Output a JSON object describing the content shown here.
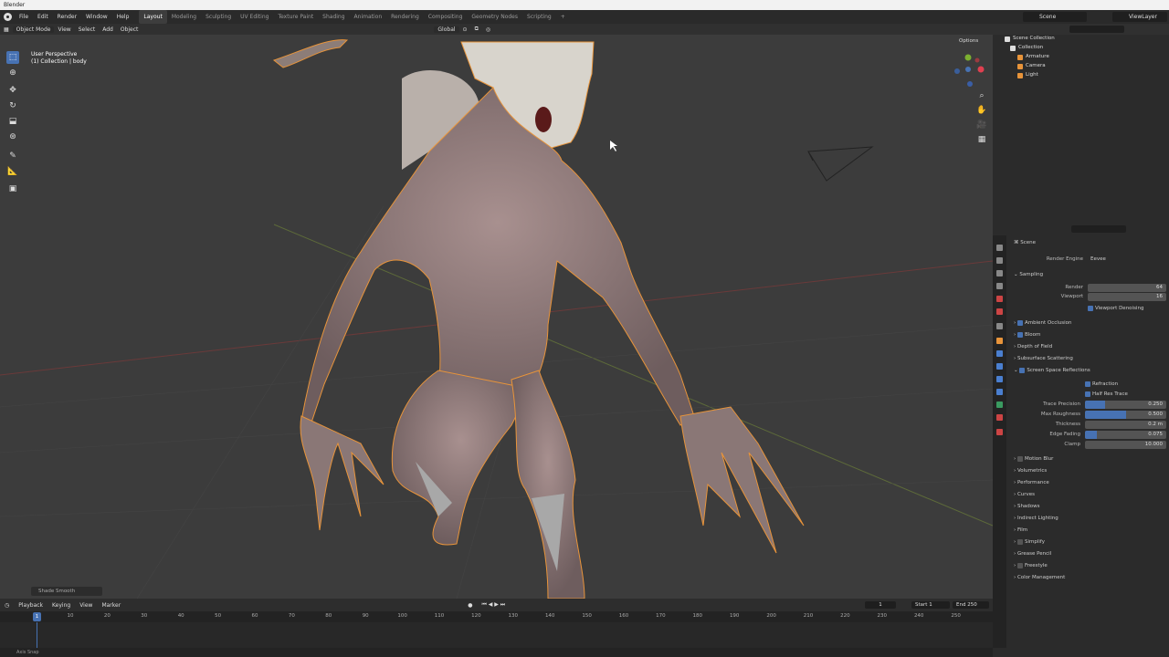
{
  "window_title": "Blender",
  "menu": [
    "File",
    "Edit",
    "Render",
    "Window",
    "Help"
  ],
  "workspaces": [
    "Layout",
    "Modeling",
    "Sculpting",
    "UV Editing",
    "Texture Paint",
    "Shading",
    "Animation",
    "Rendering",
    "Compositing",
    "Geometry Nodes",
    "Scripting",
    "+"
  ],
  "scene": "Scene",
  "view_layer": "ViewLayer",
  "viewport": {
    "mode": "Object Mode",
    "menus": [
      "View",
      "Select",
      "Add",
      "Object"
    ],
    "orientation": "Global",
    "perspective": "User Perspective",
    "collection_info": "(1) Collection | body",
    "options": "Options",
    "last_op": "Shade Smooth"
  },
  "timeline": {
    "menus": [
      "Playback",
      "Keying",
      "View",
      "Marker"
    ],
    "current_frame": "1",
    "start_label": "Start",
    "start": "1",
    "end_label": "End",
    "end": "250",
    "playhead": "1",
    "ticks": [
      "10",
      "20",
      "30",
      "40",
      "50",
      "60",
      "70",
      "80",
      "90",
      "100",
      "110",
      "120",
      "130",
      "140",
      "150",
      "160",
      "170",
      "180",
      "190",
      "200",
      "210",
      "220",
      "230",
      "240",
      "250"
    ]
  },
  "status": "Axis Snap",
  "outliner": {
    "root": "Scene Collection",
    "collection": "Collection",
    "items": [
      "Armature",
      "Camera",
      "Light"
    ]
  },
  "properties": {
    "context": "Scene",
    "render_engine_label": "Render Engine",
    "render_engine": "Eevee",
    "sampling": "Sampling",
    "render_label": "Render",
    "render_samples": "64",
    "viewport_label": "Viewport",
    "viewport_samples": "16",
    "viewport_denoising": "Viewport Denoising",
    "ambient_occlusion": "Ambient Occlusion",
    "bloom": "Bloom",
    "depth_of_field": "Depth of Field",
    "subsurface": "Subsurface Scattering",
    "ssr": "Screen Space Reflections",
    "refraction": "Refraction",
    "half_res": "Half Res Trace",
    "trace_precision_label": "Trace Precision",
    "trace_precision": "0.250",
    "max_roughness_label": "Max Roughness",
    "max_roughness": "0.500",
    "thickness_label": "Thickness",
    "thickness": "0.2 m",
    "edge_fading_label": "Edge Fading",
    "edge_fading": "0.075",
    "clamp_label": "Clamp",
    "clamp": "10.000",
    "motion_blur": "Motion Blur",
    "volumetrics": "Volumetrics",
    "performance": "Performance",
    "curves": "Curves",
    "shadows": "Shadows",
    "indirect_lighting": "Indirect Lighting",
    "film": "Film",
    "simplify": "Simplify",
    "grease_pencil": "Grease Pencil",
    "freestyle": "Freestyle",
    "color_management": "Color Management"
  },
  "colors": {
    "accent": "#4772b3",
    "selection_outline": "#e8943a",
    "viewport_bg": "#3c3c3c"
  }
}
